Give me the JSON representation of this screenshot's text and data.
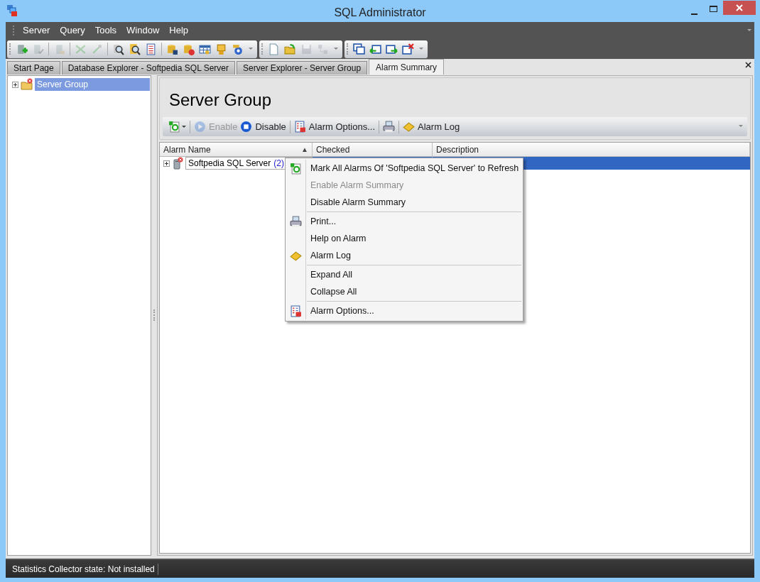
{
  "window": {
    "title": "SQL Administrator"
  },
  "menu": [
    "Server",
    "Query",
    "Tools",
    "Window",
    "Help"
  ],
  "toolbars": [
    {
      "sections": [
        [
          {
            "disabled": false
          },
          {
            "disabled": true
          }
        ],
        [
          {
            "disabled": true
          }
        ],
        [
          {
            "disabled": true
          },
          {
            "disabled": true
          }
        ],
        [
          {
            "disabled": false
          },
          {
            "disabled": false
          },
          {
            "disabled": false
          }
        ],
        [
          {
            "disabled": false
          },
          {
            "disabled": false
          },
          {
            "disabled": false
          },
          {
            "disabled": false
          },
          {
            "disabled": false
          }
        ]
      ]
    },
    {
      "sections": [
        [
          {
            "disabled": false
          },
          {
            "disabled": false
          },
          {
            "disabled": true
          },
          {
            "disabled": true
          }
        ]
      ]
    },
    {
      "sections": [
        [
          {
            "disabled": false
          },
          {
            "disabled": false
          },
          {
            "disabled": false
          },
          {
            "disabled": false
          }
        ]
      ]
    }
  ],
  "tabs": [
    {
      "label": "Start Page",
      "selected": false
    },
    {
      "label": "Database Explorer - Softpedia SQL Server",
      "selected": false
    },
    {
      "label": "Server Explorer - Server Group",
      "selected": false
    },
    {
      "label": "Alarm Summary",
      "selected": true
    }
  ],
  "tree": [
    {
      "label": "Server Group",
      "selected": true,
      "expanded": false
    }
  ],
  "panel": {
    "title": "Server Group",
    "toolbar": [
      {
        "kind": "icon",
        "disabled": false
      },
      {
        "kind": "text",
        "label": "Enable",
        "disabled": true
      },
      {
        "kind": "text",
        "label": "Disable",
        "disabled": false
      },
      {
        "kind": "text",
        "label": "Alarm Options...",
        "disabled": false
      },
      {
        "kind": "icon",
        "disabled": false
      },
      {
        "kind": "text",
        "label": "Alarm Log",
        "disabled": false
      }
    ],
    "table": {
      "columns": [
        {
          "label": "Alarm Name",
          "sort": "▲"
        },
        {
          "label": "Checked"
        },
        {
          "label": "Description"
        }
      ],
      "rows": [
        {
          "name": "Softpedia SQL Server",
          "count": "(2)",
          "selected": true,
          "expanded": false
        }
      ]
    }
  },
  "context_menu": [
    {
      "kind": "item",
      "label": "Mark All Alarms Of 'Softpedia SQL Server' to Refresh",
      "disabled": false
    },
    {
      "kind": "item",
      "label": "Enable Alarm Summary",
      "disabled": true
    },
    {
      "kind": "item",
      "label": "Disable Alarm Summary",
      "disabled": false
    },
    {
      "kind": "separator"
    },
    {
      "kind": "item",
      "label": "Print...",
      "disabled": false
    },
    {
      "kind": "item",
      "label": "Help on Alarm",
      "disabled": false
    },
    {
      "kind": "item",
      "label": "Alarm Log",
      "disabled": false
    },
    {
      "kind": "separator"
    },
    {
      "kind": "item",
      "label": "Expand All",
      "disabled": false
    },
    {
      "kind": "item",
      "label": "Collapse All",
      "disabled": false
    },
    {
      "kind": "separator"
    },
    {
      "kind": "item",
      "label": "Alarm Options...",
      "disabled": false
    }
  ],
  "status_bar": "Statistics Collector state: Not installed"
}
